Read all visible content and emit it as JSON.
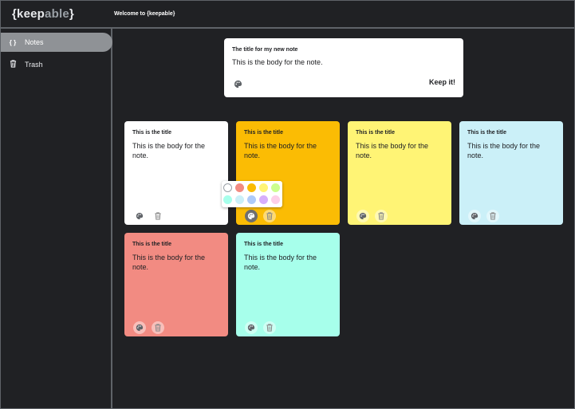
{
  "header": {
    "logo_brace_open": "{",
    "logo_keep": "keep",
    "logo_able": "able",
    "logo_brace_close": "}",
    "welcome": "Welcome to {keepable}"
  },
  "sidebar": {
    "items": [
      {
        "label": "Notes",
        "icon": "braces-icon",
        "icon_glyph": "{ }",
        "active": true
      },
      {
        "label": "Trash",
        "icon": "trash-icon",
        "active": false
      }
    ]
  },
  "compose": {
    "title": "The title for my new note",
    "body": "This is the body for the note.",
    "submit_label": "Keep it!"
  },
  "notes": [
    {
      "title": "This is the title",
      "body": "This is the body for the note.",
      "color": "#ffffff"
    },
    {
      "title": "This is the title",
      "body": "This is the body for the note.",
      "color": "#fbbc04"
    },
    {
      "title": "This is the title",
      "body": "This is the body for the note.",
      "color": "#fff475"
    },
    {
      "title": "This is the title",
      "body": "This is the body for the note.",
      "color": "#cbf0f8"
    },
    {
      "title": "This is the title",
      "body": "This is the body for the note.",
      "color": "#f28b82"
    },
    {
      "title": "This is the title",
      "body": "This is the body for the note.",
      "color": "#a7ffeb"
    }
  ],
  "color_palette": [
    "#ffffff",
    "#f28b82",
    "#fbbc04",
    "#fff475",
    "#ccff90",
    "#a7ffeb",
    "#cbf0f8",
    "#aecbfa",
    "#d7aefb",
    "#fdcfe8"
  ],
  "colors": {
    "background": "#202124",
    "border": "#5f6368",
    "active_nav": "#8f9296"
  }
}
